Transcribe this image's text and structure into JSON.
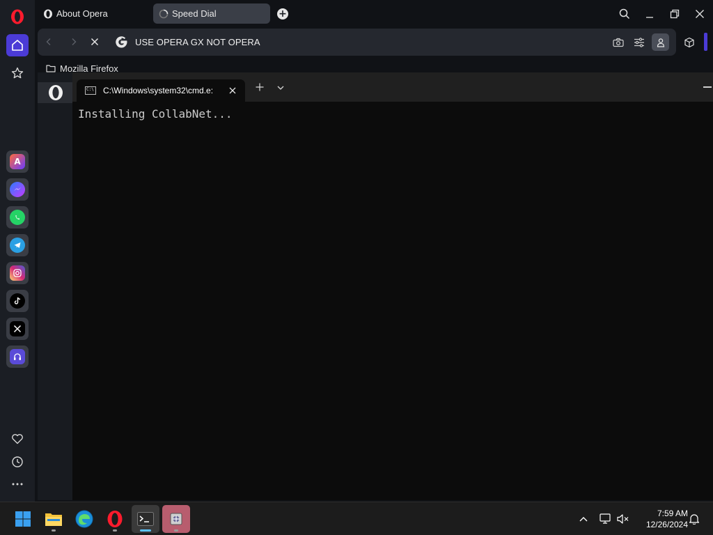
{
  "browser": {
    "tabs": [
      {
        "label": "About Opera"
      },
      {
        "label": "Speed Dial"
      }
    ],
    "address_bar": {
      "text": "USE OPERA GX NOT OPERA"
    },
    "bookmarks": [
      {
        "label": "Mozilla Firefox"
      }
    ],
    "accent_color": "#4b3bd6"
  },
  "sidebar": {
    "top_items": [
      "home-icon",
      "star-icon"
    ],
    "apps": [
      "aria-icon",
      "messenger-icon",
      "whatsapp-icon",
      "telegram-icon",
      "instagram-icon",
      "tiktok-icon",
      "x-icon",
      "music-player-icon"
    ],
    "bottom_items": [
      "heart-icon",
      "history-icon",
      "more-icon"
    ]
  },
  "terminal": {
    "tab_title": "C:\\Windows\\system32\\cmd.e:",
    "output": "Installing CollabNet..."
  },
  "taskbar": {
    "apps": [
      "windows-start-icon",
      "file-explorer-icon",
      "edge-icon",
      "opera-icon",
      "terminal-icon",
      "installer-icon"
    ],
    "time": "7:59 AM",
    "date": "12/26/2024"
  }
}
